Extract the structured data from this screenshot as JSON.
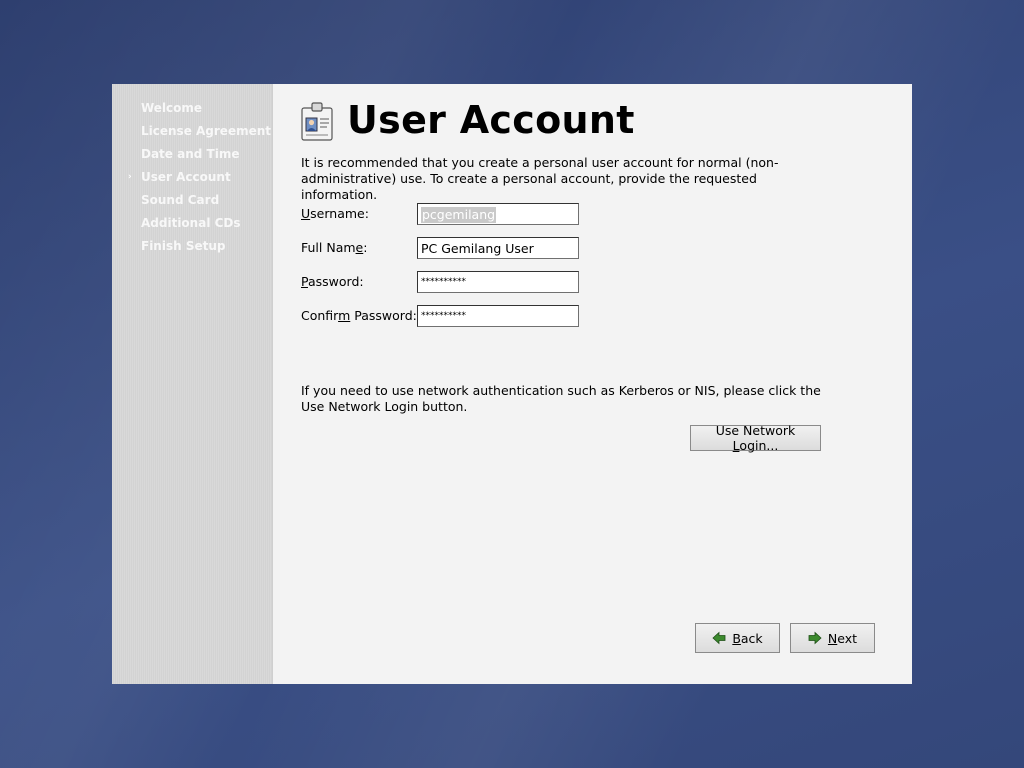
{
  "sidebar": {
    "steps": [
      {
        "label": "Welcome"
      },
      {
        "label": "License Agreement"
      },
      {
        "label": "Date and Time"
      },
      {
        "label": "User Account",
        "current": true
      },
      {
        "label": "Sound Card"
      },
      {
        "label": "Additional CDs"
      },
      {
        "label": "Finish Setup"
      }
    ],
    "current_marker": "›"
  },
  "header": {
    "title": "User Account",
    "icon": "id-card-icon"
  },
  "intro_text": "It is recommended that you create a personal user account for normal (non-administrative) use.  To create a personal account, provide the requested information.",
  "form": {
    "username": {
      "label_pre": "",
      "label_key": "U",
      "label_post": "sername:",
      "value": "pcgemilang"
    },
    "full_name": {
      "label_pre": "Full Nam",
      "label_key": "e",
      "label_post": ":",
      "value": "PC Gemilang User"
    },
    "password": {
      "label_pre": "",
      "label_key": "P",
      "label_post": "assword:",
      "value": "**********"
    },
    "confirm_password": {
      "label_pre": "Confir",
      "label_key": "m",
      "label_post": " Password:",
      "value": "**********"
    }
  },
  "network": {
    "text": "If you need to use network authentication such as Kerberos or NIS, please click the Use Network Login button.",
    "button_pre": "Use Network ",
    "button_key": "L",
    "button_post": "ogin..."
  },
  "nav": {
    "back_key": "B",
    "back_rest": "ack",
    "next_key": "N",
    "next_rest": "ext"
  },
  "colors": {
    "desktop": "#34477a",
    "window": "#f3f3f3",
    "sidebar": "#d6d6d6",
    "arrow_green": "#3c8a2e"
  }
}
